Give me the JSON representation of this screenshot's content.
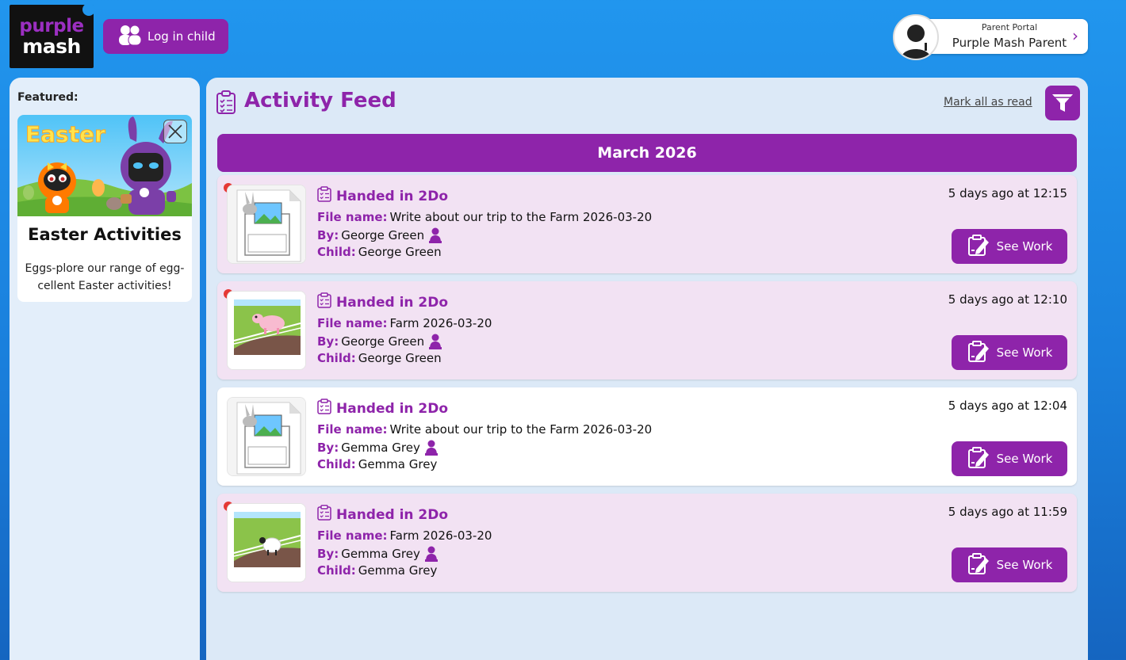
{
  "logo": {
    "line1": "purple",
    "line2": "mash"
  },
  "header": {
    "login_child_label": "Log in child",
    "portal_label": "Parent Portal",
    "portal_user": "Purple Mash Parent"
  },
  "sidebar": {
    "featured_label": "Featured:",
    "card": {
      "banner_word": "Easter",
      "title": "Easter Activities",
      "description": "Eggs-plore our range of egg-cellent Easter activities!"
    }
  },
  "feed": {
    "title": "Activity Feed",
    "mark_all_read": "Mark all as read",
    "month_header": "March 2026",
    "labels": {
      "file_name": "File name:",
      "by": "By:",
      "child": "Child:",
      "see_work": "See Work"
    },
    "items": [
      {
        "title": "Handed in 2Do",
        "file_name": "Write about our trip to the Farm 2026-03-20",
        "by": "George Green",
        "child": "George Green",
        "time": "5 days ago at 12:15",
        "unread": true,
        "thumb": "writing-template"
      },
      {
        "title": "Handed in 2Do",
        "file_name": "Farm 2026-03-20",
        "by": "George Green",
        "child": "George Green",
        "time": "5 days ago at 12:10",
        "unread": true,
        "thumb": "farm-pig"
      },
      {
        "title": "Handed in 2Do",
        "file_name": "Write about our trip to the Farm 2026-03-20",
        "by": "Gemma Grey",
        "child": "Gemma Grey",
        "time": "5 days ago at 12:04",
        "unread": false,
        "thumb": "writing-template"
      },
      {
        "title": "Handed in 2Do",
        "file_name": "Farm 2026-03-20",
        "by": "Gemma Grey",
        "child": "Gemma Grey",
        "time": "5 days ago at 11:59",
        "unread": true,
        "thumb": "farm-sheep"
      }
    ]
  },
  "colors": {
    "brand_purple": "#8e24aa",
    "unread_bg": "#f2e2f3",
    "unread_dot": "#e53935"
  }
}
